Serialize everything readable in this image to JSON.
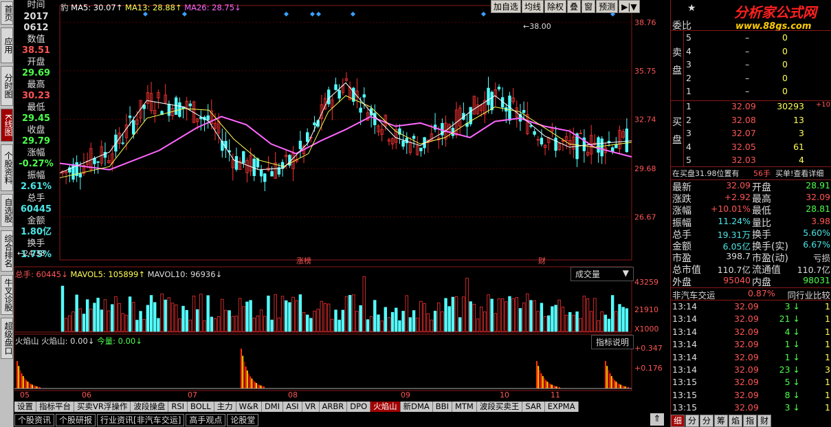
{
  "left_tabs": [
    {
      "label": "首页",
      "active": false
    },
    {
      "label": "应用",
      "active": false
    },
    {
      "label": "分时图",
      "active": false
    },
    {
      "label": "K线图",
      "active": true
    },
    {
      "label": "个股资料",
      "active": false
    },
    {
      "label": "自选股",
      "active": false
    },
    {
      "label": "综合排名",
      "active": false
    },
    {
      "label": "牛叉诊股",
      "active": false
    },
    {
      "label": "超级盘口",
      "active": false
    }
  ],
  "info": [
    {
      "label": "时间",
      "value": "2017"
    },
    {
      "label": "",
      "value": "0612"
    },
    {
      "label": "数值",
      "value": "38.51",
      "color": "#ff5555"
    },
    {
      "label": "开盘",
      "value": "29.69",
      "color": "#4cff4c"
    },
    {
      "label": "最高",
      "value": "30.23",
      "color": "#ff5555"
    },
    {
      "label": "最低",
      "value": "29.45",
      "color": "#4cff4c"
    },
    {
      "label": "收盘",
      "value": "29.79",
      "color": "#4cff4c"
    },
    {
      "label": "涨幅",
      "value": "-0.27%",
      "color": "#4cff4c"
    },
    {
      "label": "振幅",
      "value": "2.61%",
      "color": "#4ce6e6"
    },
    {
      "label": "总手",
      "value": "60445",
      "color": "#4ce6e6"
    },
    {
      "label": "金额",
      "value": "1.80亿",
      "color": "#4ce6e6"
    },
    {
      "label": "换手",
      "value": "1.75%",
      "color": "#4ce6e6"
    }
  ],
  "legend": {
    "name": "豹",
    "ma5": "MA5: 30.07↑",
    "ma13": "MA13: 28.88↑",
    "ma26": "MA26: 28.75↓",
    "ma5_color": "#ffffff",
    "ma13_color": "#ffff55",
    "ma26_color": "#ff66ff"
  },
  "toolbar": [
    "加自选",
    "均线",
    "除权",
    "叠",
    "窗",
    "预测",
    "▶|▼"
  ],
  "price_axis": [
    "38.76",
    "35.75",
    "32.74",
    "29.68",
    "26.67"
  ],
  "annotations": {
    "high": "38.00",
    "low": "24.38",
    "event1": "涨榜",
    "event2": "财"
  },
  "vol_legend": {
    "a": "总手: 60445↓",
    "b": "MAVOL5: 105899↑",
    "c": "MAVOL10: 96936↓"
  },
  "vol_dropdown": "成交量",
  "vol_axis": [
    "43259",
    "21910",
    "X1000"
  ],
  "ind_legend": {
    "a": "火焰山 火焰山: 0.00↓",
    "b": "今量: 0.00↓"
  },
  "ind_button": "指标说明",
  "ind_axis": [
    "+0.347",
    "+0.176"
  ],
  "months": [
    "05",
    "06",
    "07",
    "08",
    "09",
    "10",
    "11"
  ],
  "bottom_tabs": [
    {
      "label": "设置",
      "active": false
    },
    {
      "label": "指标平台",
      "active": false
    },
    {
      "label": "买卖VR浮操作",
      "active": false
    },
    {
      "label": "波段操盘",
      "active": false
    },
    {
      "label": "RSI",
      "active": false
    },
    {
      "label": "BOLL",
      "active": false
    },
    {
      "label": "主力",
      "active": false
    },
    {
      "label": "W&R",
      "active": false
    },
    {
      "label": "DMI",
      "active": false
    },
    {
      "label": "ASI",
      "active": false
    },
    {
      "label": "VR",
      "active": false
    },
    {
      "label": "ARBR",
      "active": false
    },
    {
      "label": "DPO",
      "active": false
    },
    {
      "label": "火焰山",
      "active": true
    },
    {
      "label": "新DMA",
      "active": false
    },
    {
      "label": "BBI",
      "active": false
    },
    {
      "label": "MTM",
      "active": false
    },
    {
      "label": "波段买卖王",
      "active": false
    },
    {
      "label": "SAR",
      "active": false
    },
    {
      "label": "EXPMA",
      "active": false
    }
  ],
  "bottom_tabs2": [
    "个股资讯",
    "个股研报",
    "行业资讯[非汽车交运]",
    "高手观点",
    "论股堂"
  ],
  "right": {
    "logo_title": "分析家公式网",
    "logo_url": "www.88gs.com",
    "weibi": "委比",
    "sell_label": "卖盘",
    "buy_label": "买盘",
    "sell": [
      {
        "n": "5",
        "p": "–",
        "v": "0"
      },
      {
        "n": "4",
        "p": "–",
        "v": "0"
      },
      {
        "n": "3",
        "p": "–",
        "v": "0"
      },
      {
        "n": "2",
        "p": "–",
        "v": "0"
      },
      {
        "n": "1",
        "p": "–",
        "v": "0"
      }
    ],
    "buy": [
      {
        "n": "1",
        "p": "32.09",
        "v": "30293",
        "x": "+10"
      },
      {
        "n": "2",
        "p": "32.08",
        "v": "13",
        "x": ""
      },
      {
        "n": "3",
        "p": "32.07",
        "v": "3",
        "x": ""
      },
      {
        "n": "4",
        "p": "32.05",
        "v": "61",
        "x": ""
      },
      {
        "n": "5",
        "p": "32.03",
        "v": "4",
        "x": ""
      }
    ],
    "note_a": "在买盘31.98位置有",
    "note_b": "56手",
    "note_c": "买单!查看详细",
    "stats": [
      {
        "l1": "最新",
        "v1": "32.09",
        "c1": "#ff5555",
        "l2": "开盘",
        "v2": "28.91",
        "c2": "#4cff4c"
      },
      {
        "l1": "涨跌",
        "v1": "+2.92",
        "c1": "#ff5555",
        "l2": "最高",
        "v2": "32.09",
        "c2": "#ff5555"
      },
      {
        "l1": "涨幅",
        "v1": "+10.01%",
        "c1": "#ff5555",
        "l2": "最低",
        "v2": "28.81",
        "c2": "#4cff4c"
      },
      {
        "l1": "振幅",
        "v1": "11.24%",
        "c1": "#4ce6e6",
        "l2": "量比",
        "v2": "3.98",
        "c2": "#ff5555"
      },
      {
        "l1": "总手",
        "v1": "19.31万",
        "c1": "#4ce6e6",
        "l2": "换手",
        "v2": "5.60%",
        "c2": "#4ce6e6"
      },
      {
        "l1": "金额",
        "v1": "6.05亿",
        "c1": "#4ce6e6",
        "l2": "换手(实)",
        "v2": "6.67%",
        "c2": "#4ce6e6"
      },
      {
        "l1": "市盈",
        "v1": "398.7",
        "c1": "#dddddd",
        "l2": "市盈(动)",
        "v2": "亏损",
        "c2": "#dddddd"
      },
      {
        "l1": "总市值",
        "v1": "110.7亿",
        "c1": "#dddddd",
        "l2": "流通值",
        "v2": "110.7亿",
        "c2": "#dddddd"
      },
      {
        "l1": "外盘",
        "v1": "95040",
        "c1": "#ff5555",
        "l2": "内盘",
        "v2": "98031",
        "c2": "#4cff4c"
      }
    ],
    "industry": "非汽车交运",
    "industry_pct": "0.87%",
    "industry_link": "同行业比较",
    "ticks": [
      {
        "t": "13:14",
        "p": "32.09",
        "v": "3",
        "d": "1"
      },
      {
        "t": "13:14",
        "p": "32.09",
        "v": "21",
        "d": "1"
      },
      {
        "t": "13:14",
        "p": "32.09",
        "v": "4",
        "d": "1"
      },
      {
        "t": "13:14",
        "p": "32.09",
        "v": "1",
        "d": "1"
      },
      {
        "t": "13:14",
        "p": "32.09",
        "v": "1",
        "d": "1"
      },
      {
        "t": "13:14",
        "p": "32.09",
        "v": "23",
        "d": "3"
      },
      {
        "t": "13:15",
        "p": "32.09",
        "v": "5",
        "d": "1"
      },
      {
        "t": "13:15",
        "p": "32.09",
        "v": "8",
        "d": "1"
      },
      {
        "t": "13:15",
        "p": "32.09",
        "v": "3",
        "d": "1"
      }
    ],
    "tabs": [
      "细",
      "分",
      "分",
      "筹",
      "焰",
      "指",
      "财"
    ]
  },
  "chart_data": {
    "type": "candlestick",
    "price_ticks": [
      38.76,
      35.75,
      32.74,
      29.68,
      26.67
    ],
    "ylim": [
      24.0,
      39.8
    ],
    "n": 160,
    "ma26": [
      [
        0,
        30.0
      ],
      [
        20,
        29.6
      ],
      [
        40,
        30.8
      ],
      [
        55,
        32.2
      ],
      [
        65,
        32.9
      ],
      [
        75,
        32.4
      ],
      [
        85,
        31.2
      ],
      [
        95,
        30.6
      ],
      [
        105,
        31.4
      ],
      [
        115,
        32.1
      ],
      [
        125,
        32.9
      ],
      [
        135,
        32.3
      ],
      [
        145,
        32.5
      ],
      [
        155,
        32.0
      ],
      [
        165,
        31.6
      ],
      [
        175,
        32.6
      ],
      [
        185,
        32.8
      ],
      [
        195,
        32.3
      ],
      [
        205,
        32.0
      ],
      [
        215,
        31.0
      ],
      [
        230,
        30.4
      ]
    ],
    "ma13": [
      [
        0,
        29.1
      ],
      [
        20,
        29.8
      ],
      [
        35,
        32.8
      ],
      [
        50,
        33.4
      ],
      [
        60,
        33.3
      ],
      [
        70,
        31.5
      ],
      [
        80,
        30.2
      ],
      [
        90,
        29.8
      ],
      [
        100,
        30.6
      ],
      [
        108,
        33.2
      ],
      [
        115,
        34.2
      ],
      [
        125,
        33.5
      ],
      [
        135,
        32.0
      ],
      [
        145,
        31.2
      ],
      [
        155,
        31.6
      ],
      [
        165,
        32.6
      ],
      [
        175,
        33.5
      ],
      [
        185,
        33.2
      ],
      [
        195,
        32.2
      ],
      [
        205,
        31.2
      ],
      [
        215,
        31.0
      ],
      [
        230,
        31.3
      ]
    ],
    "ma5": [
      [
        0,
        29.4
      ],
      [
        20,
        30.7
      ],
      [
        35,
        33.9
      ],
      [
        50,
        33.5
      ],
      [
        60,
        32.6
      ],
      [
        70,
        30.2
      ],
      [
        80,
        29.6
      ],
      [
        90,
        29.7
      ],
      [
        100,
        31.3
      ],
      [
        108,
        34.0
      ],
      [
        115,
        35.0
      ],
      [
        125,
        33.2
      ],
      [
        135,
        31.6
      ],
      [
        145,
        31.1
      ],
      [
        155,
        32.0
      ],
      [
        165,
        33.2
      ],
      [
        175,
        34.2
      ],
      [
        185,
        33.0
      ],
      [
        195,
        31.7
      ],
      [
        205,
        31.0
      ],
      [
        215,
        31.2
      ],
      [
        230,
        31.4
      ]
    ],
    "vol_ticks": [
      43259,
      21910
    ],
    "ind_ticks": [
      0.347,
      0.176
    ],
    "ind_spikes": [
      [
        0,
        0.25
      ],
      [
        150,
        0.38
      ],
      [
        280,
        0.2
      ],
      [
        330,
        0.18
      ]
    ]
  }
}
